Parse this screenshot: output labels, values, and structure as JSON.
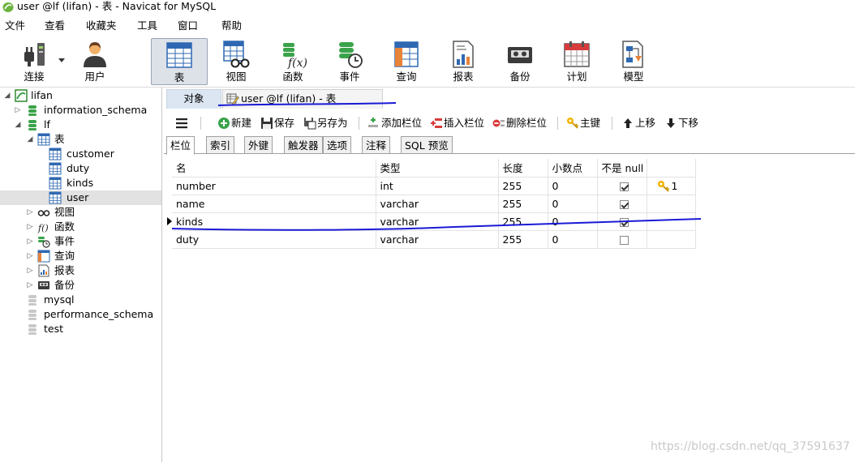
{
  "window": {
    "title": "user @lf (lifan) - 表 - Navicat for MySQL"
  },
  "menu": [
    "文件",
    "查看",
    "收藏夹",
    "工具",
    "窗口",
    "帮助"
  ],
  "toolbar": [
    {
      "label": "连接",
      "icon": "plug-icon"
    },
    {
      "label": "用户",
      "icon": "user-icon"
    },
    {
      "label": "表",
      "icon": "table-icon",
      "active": true
    },
    {
      "label": "视图",
      "icon": "view-icon"
    },
    {
      "label": "函数",
      "icon": "function-icon"
    },
    {
      "label": "事件",
      "icon": "event-icon"
    },
    {
      "label": "查询",
      "icon": "query-icon"
    },
    {
      "label": "报表",
      "icon": "report-icon"
    },
    {
      "label": "备份",
      "icon": "backup-icon"
    },
    {
      "label": "计划",
      "icon": "calendar-icon"
    },
    {
      "label": "模型",
      "icon": "model-icon"
    }
  ],
  "tree": {
    "connection": "lifan",
    "databases_top": [
      "information_schema",
      "lf"
    ],
    "tables_folder": "表",
    "tables": [
      "customer",
      "duty",
      "kinds",
      "user"
    ],
    "selected_table": "user",
    "folders": [
      "视图",
      "函数",
      "事件",
      "查询",
      "报表",
      "备份"
    ],
    "databases_bottom": [
      "mysql",
      "performance_schema",
      "test"
    ]
  },
  "tabs": {
    "objects": "对象",
    "current": "user @lf (lifan) - 表"
  },
  "actions": {
    "new": "新建",
    "save": "保存",
    "save_as": "另存为",
    "add_field": "添加栏位",
    "insert_field": "插入栏位",
    "delete_field": "删除栏位",
    "primary_key": "主键",
    "move_up": "上移",
    "move_down": "下移"
  },
  "subtabs": [
    "栏位",
    "索引",
    "外键",
    "触发器",
    "选项",
    "注释",
    "SQL 预览"
  ],
  "fields": {
    "columns": [
      "名",
      "类型",
      "长度",
      "小数点",
      "不是 null",
      ""
    ],
    "rows": [
      {
        "name": "number",
        "type": "int",
        "length": "255",
        "decimals": "0",
        "not_null": true,
        "key": "1"
      },
      {
        "name": "name",
        "type": "varchar",
        "length": "255",
        "decimals": "0",
        "not_null": true,
        "key": ""
      },
      {
        "name": "kinds",
        "type": "varchar",
        "length": "255",
        "decimals": "0",
        "not_null": true,
        "key": ""
      },
      {
        "name": "duty",
        "type": "varchar",
        "length": "255",
        "decimals": "0",
        "not_null": false,
        "key": ""
      }
    ],
    "current_row": 2
  },
  "watermark": "https://blog.csdn.net/qq_37591637",
  "colors": {
    "annotation_ink": "#1a1ad6",
    "active_tab": "#dbe6f2",
    "selection": "#e2e2e2"
  }
}
